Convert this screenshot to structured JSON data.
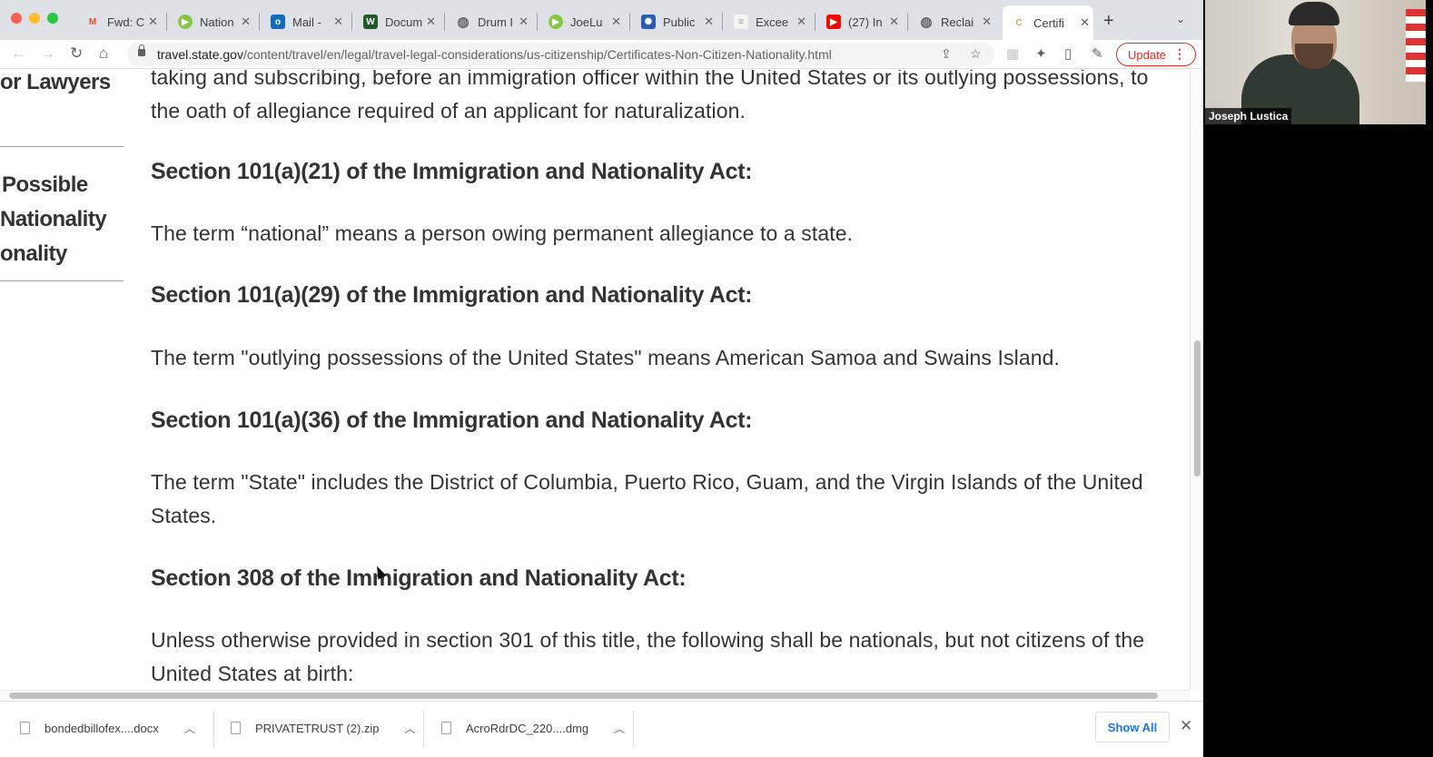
{
  "browser": {
    "tabs": [
      {
        "label": "Fwd: C",
        "icon": "gmail-icon",
        "color": "#ea4335"
      },
      {
        "label": "Nation",
        "icon": "rumble-icon",
        "color": "#85c742"
      },
      {
        "label": "Mail - ",
        "icon": "outlook-icon",
        "color": "#0f6cbd"
      },
      {
        "label": "Docum",
        "icon": "document-icon",
        "color": "#1e5a2a"
      },
      {
        "label": "Drum I",
        "icon": "globe-icon",
        "color": "#5f6368"
      },
      {
        "label": "JoeLu",
        "icon": "rumble-icon",
        "color": "#85c742"
      },
      {
        "label": "Public",
        "icon": "seal-icon",
        "color": "#2a5db0"
      },
      {
        "label": "Excee",
        "icon": "doc-page-icon",
        "color": "#e8eaed"
      },
      {
        "label": "(27) In",
        "icon": "youtube-icon",
        "color": "#ff0000"
      },
      {
        "label": "Reclai",
        "icon": "globe-icon",
        "color": "#5f6368"
      },
      {
        "label": "Certifi",
        "icon": "state-seal-icon",
        "color": "#c8a96a",
        "active": true
      }
    ],
    "new_tab": "+",
    "tab_menu": "⌄",
    "url_host": "travel.state.gov",
    "url_path": "/content/travel/en/legal/travel-legal-considerations/us-citizenship/Certificates-Non-Citizen-Nationality.html",
    "update_label": "Update"
  },
  "sidenav": {
    "item1": "or Lawyers",
    "item2_lines": [
      "Possible",
      "Nationality",
      "onality"
    ]
  },
  "content": {
    "p0": "taking and subscribing, before an immigration officer within the United States or its outlying possessions, to the oath of allegiance required of an applicant for naturalization.",
    "h1": "Section 101(a)(21) of the Immigration and Nationality Act:",
    "p1": "The term “national” means a person owing permanent allegiance to a state.",
    "h2": "Section 101(a)(29) of the Immigration and Nationality Act:",
    "p2": "The term \"outlying possessions of the United States\" means American Samoa and Swains Island.",
    "h3": "Section 101(a)(36) of the Immigration and Nationality Act:",
    "p3": "The term \"State\" includes the District of Columbia, Puerto Rico, Guam, and the Virgin Islands of the United States.",
    "h4": "Section 308 of the Immigration and Nationality Act:",
    "p4": "Unless otherwise provided in section 301 of this title, the following shall be nationals, but not citizens of the United States at birth:"
  },
  "downloads": {
    "items": [
      {
        "name": "bondedbillofex....docx"
      },
      {
        "name": "PRIVATETRUST (2).zip"
      },
      {
        "name": "AcroRdrDC_220....dmg"
      }
    ],
    "show_all": "Show All"
  },
  "video": {
    "participant_name": "Joseph Lustica"
  }
}
